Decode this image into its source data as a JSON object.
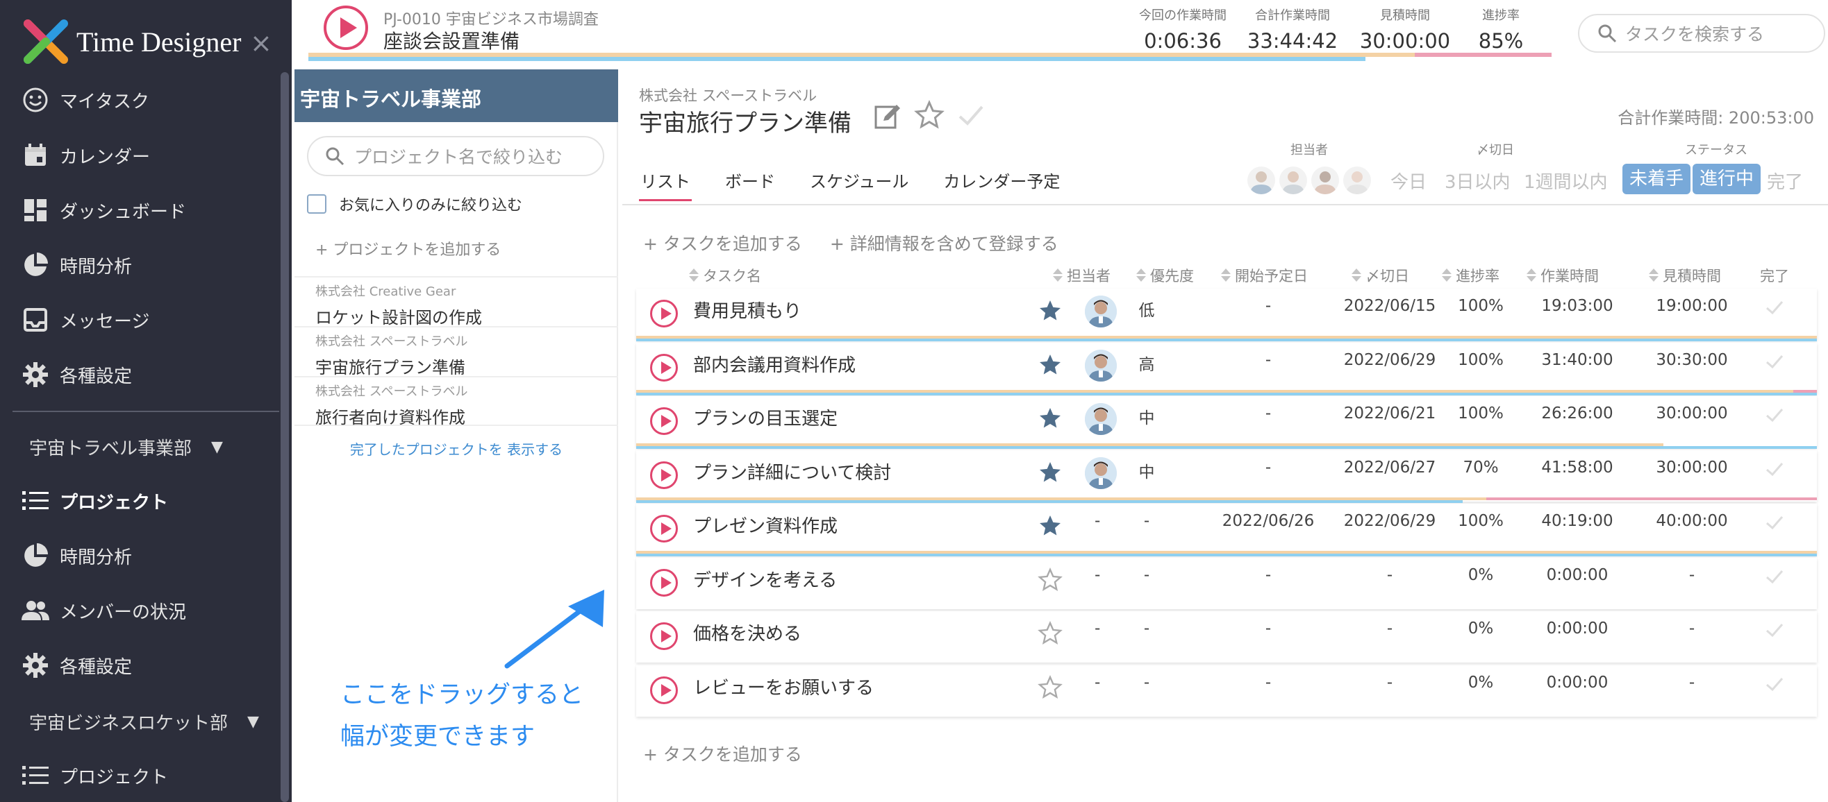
{
  "app": {
    "name": "Time Designer",
    "close_glyph": "×"
  },
  "nav": {
    "items": [
      {
        "label": "マイタスク",
        "icon": "smiley-icon"
      },
      {
        "label": "カレンダー",
        "icon": "calendar-icon"
      },
      {
        "label": "ダッシュボード",
        "icon": "dashboard-icon"
      },
      {
        "label": "時間分析",
        "icon": "pie-chart-icon"
      },
      {
        "label": "メッセージ",
        "icon": "inbox-icon"
      },
      {
        "label": "各種設定",
        "icon": "gear-icon"
      }
    ],
    "group1": {
      "label": "宇宙トラベル事業部",
      "arrow": "▼"
    },
    "group1_items": [
      {
        "label": "プロジェクト",
        "icon": "list-icon",
        "active": true
      },
      {
        "label": "時間分析",
        "icon": "pie-chart-icon"
      },
      {
        "label": "メンバーの状況",
        "icon": "people-icon"
      },
      {
        "label": "各種設定",
        "icon": "gear-icon"
      }
    ],
    "group2": {
      "label": "宇宙ビジネスロケット部",
      "arrow": "▼"
    },
    "group2_items": [
      {
        "label": "プロジェクト",
        "icon": "list-icon"
      }
    ]
  },
  "topbar": {
    "project_code": "PJ-0010 宇宙ビジネス市場調査",
    "task": "座談会設置準備",
    "stats": [
      {
        "label": "今回の作業時間",
        "value": "0:06:36"
      },
      {
        "label": "合計作業時間",
        "value": "33:44:42"
      },
      {
        "label": "見積時間",
        "value": "30:00:00"
      },
      {
        "label": "進捗率",
        "value": "85%"
      }
    ],
    "search_placeholder": "タスクを検索する",
    "progress": {
      "estimate": 1.0,
      "actual": 0.85
    }
  },
  "projects": {
    "department": "宇宙トラベル事業部",
    "filter_placeholder": "プロジェクト名で絞り込む",
    "fav_only": "お気に入りのみに絞り込む",
    "add": "+ プロジェクトを追加する",
    "items": [
      {
        "company": "株式会社 Creative Gear",
        "name": "ロケット設計図の作成"
      },
      {
        "company": "株式会社 スペーストラベル",
        "name": "宇宙旅行プラン準備"
      },
      {
        "company": "株式会社 スペーストラベル",
        "name": "旅行者向け資料作成"
      }
    ],
    "show_done": "完了したプロジェクトを 表示する"
  },
  "hint": {
    "line1": "ここをドラッグすると",
    "line2": "幅が変更できます"
  },
  "main": {
    "company": "株式会社 スペーストラベル",
    "title": "宇宙旅行プラン準備",
    "total": "合計作業時間: 200:53:00",
    "tabs": [
      "リスト",
      "ボード",
      "スケジュール",
      "カレンダー予定"
    ],
    "filter_labels": {
      "assignee": "担当者",
      "due": "〆切日",
      "status": "ステータス"
    },
    "due_options": [
      "今日",
      "3日以内",
      "1週間以内"
    ],
    "status_options": [
      "未着手",
      "進行中",
      "完了"
    ],
    "add_task": "+ タスクを追加する",
    "add_detail": "+ 詳細情報を含めて登録する",
    "add_task_bottom": "+ タスクを追加する",
    "columns": [
      "タスク名",
      "担当者",
      "優先度",
      "開始予定日",
      "〆切日",
      "進捗率",
      "作業時間",
      "見積時間",
      "完了"
    ],
    "tasks": [
      {
        "name": "費用見積もり",
        "starred": true,
        "assignee": true,
        "priority": "低",
        "start": "-",
        "due": "2022/06/15",
        "progress": "100%",
        "worked": "19:03:00",
        "estimate": "19:00:00",
        "bar_est": 1.0,
        "bar_act": 1.0,
        "over": 0
      },
      {
        "name": "部内会議用資料作成",
        "starred": true,
        "assignee": true,
        "priority": "高",
        "start": "-",
        "due": "2022/06/29",
        "progress": "100%",
        "worked": "31:40:00",
        "estimate": "30:30:00",
        "bar_est": 0.98,
        "bar_act": 1.0,
        "over": 0.02
      },
      {
        "name": "プランの目玉選定",
        "starred": true,
        "assignee": true,
        "priority": "中",
        "start": "-",
        "due": "2022/06/21",
        "progress": "100%",
        "worked": "26:26:00",
        "estimate": "30:00:00",
        "bar_est": 0.87,
        "bar_act": 1.0,
        "over": 0
      },
      {
        "name": "プラン詳細について検討",
        "starred": true,
        "assignee": true,
        "priority": "中",
        "start": "-",
        "due": "2022/06/27",
        "progress": "70%",
        "worked": "41:58:00",
        "estimate": "30:00:00",
        "bar_est": 0.72,
        "bar_act": 0.7,
        "over": 0.28
      },
      {
        "name": "プレゼン資料作成",
        "starred": true,
        "assignee": false,
        "priority": "-",
        "start": "2022/06/26",
        "due": "2022/06/29",
        "progress": "100%",
        "worked": "40:19:00",
        "estimate": "40:00:00",
        "bar_est": 1.0,
        "bar_act": 1.0,
        "over": 0
      },
      {
        "name": "デザインを考える",
        "starred": false,
        "assignee": false,
        "priority": "-",
        "start": "-",
        "due": "-",
        "progress": "0%",
        "worked": "0:00:00",
        "estimate": "-",
        "bar_est": 0,
        "bar_act": 0,
        "over": 0
      },
      {
        "name": "価格を決める",
        "starred": false,
        "assignee": false,
        "priority": "-",
        "start": "-",
        "due": "-",
        "progress": "0%",
        "worked": "0:00:00",
        "estimate": "-",
        "bar_est": 0,
        "bar_act": 0,
        "over": 0
      },
      {
        "name": "レビューをお願いする",
        "starred": false,
        "assignee": false,
        "priority": "-",
        "start": "-",
        "due": "-",
        "progress": "0%",
        "worked": "0:00:00",
        "estimate": "-",
        "bar_est": 0,
        "bar_act": 0,
        "over": 0
      }
    ]
  },
  "colors": {
    "accent": "#e0456e",
    "nav_bg": "#2c2e3b",
    "panel_head": "#4f6d8a",
    "link": "#3d8bd0",
    "star": "#4f6d8a",
    "badge": "#78a9d9"
  }
}
